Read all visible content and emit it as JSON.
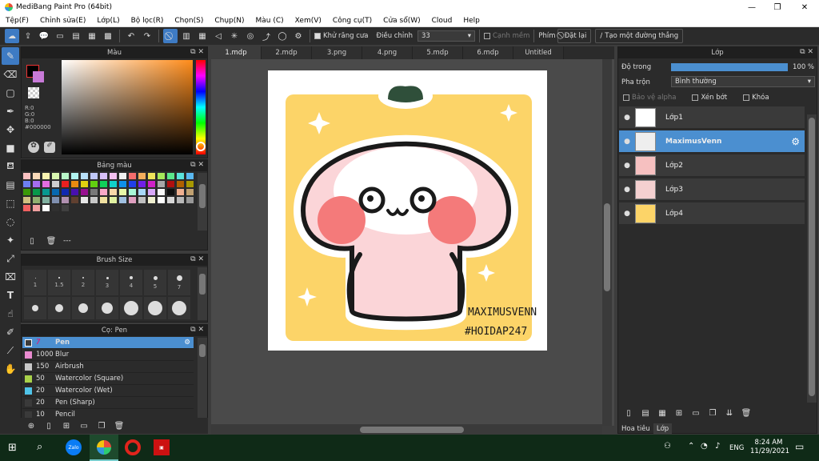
{
  "window": {
    "title": "MediBang Paint Pro (64bit)"
  },
  "menu": [
    "Tệp(F)",
    "Chỉnh sửa(E)",
    "Lớp(L)",
    "Bộ lọc(R)",
    "Chọn(S)",
    "Chụp(N)",
    "Màu (C)",
    "Xem(V)",
    "Công cụ(T)",
    "Cửa sổ(W)",
    "Cloud",
    "Help"
  ],
  "toolbar": {
    "antialias_label": "Khử răng cưa",
    "correction_label": "Điều chỉnh",
    "correction_value": "33",
    "soft_edge_label": "Cạnh mềm",
    "key_label": "Phím",
    "reset_label": "Đặt lại",
    "straight_line_label": "Tạo một đường thẳng"
  },
  "color_panel": {
    "title": "Màu",
    "r": "R:0",
    "g": "G:0",
    "b": "B:0",
    "hex": "#000000"
  },
  "palette_panel": {
    "title": "Bảng màu",
    "footer": "---"
  },
  "brush_size_panel": {
    "title": "Brush Size",
    "sizes_row1": [
      "1",
      "1.5",
      "2",
      "3",
      "4",
      "5",
      "7"
    ]
  },
  "brush_panel": {
    "title": "Cọ: Pen",
    "items": [
      {
        "size": "7",
        "name": "Pen",
        "color": "#3a3a3a",
        "selected": true
      },
      {
        "size": "1000",
        "name": "Blur",
        "color": "#e98bd0"
      },
      {
        "size": "150",
        "name": "Airbrush",
        "color": "#c8c8c8"
      },
      {
        "size": "50",
        "name": "Watercolor (Square)",
        "color": "#a8d14a"
      },
      {
        "size": "20",
        "name": "Watercolor (Wet)",
        "color": "#4fc3e8"
      },
      {
        "size": "20",
        "name": "Pen (Sharp)",
        "color": "#3a3a3a"
      },
      {
        "size": "10",
        "name": "Pencil",
        "color": "#3a3a3a"
      }
    ]
  },
  "tabs": [
    "1.mdp",
    "2.mdp",
    "3.png",
    "4.png",
    "5.mdp",
    "6.mdp",
    "Untitled"
  ],
  "canvas": {
    "signature_line1": "MAXIMUSVENN",
    "signature_line2": "#HOIDAP247"
  },
  "layer_panel": {
    "title": "Lớp",
    "opacity_label": "Độ trong",
    "opacity_value": "100 %",
    "opacity_fraction": 1.0,
    "blend_label": "Pha trộn",
    "blend_value": "Bình thường",
    "protect_alpha": "Bảo vệ alpha",
    "clipping": "Xén bớt",
    "lock": "Khóa",
    "layers": [
      {
        "name": "Lớp1",
        "selected": false
      },
      {
        "name": "MaximusVenn",
        "selected": true
      },
      {
        "name": "Lớp2",
        "selected": false
      },
      {
        "name": "Lớp3",
        "selected": false
      },
      {
        "name": "Lớp4",
        "selected": false
      }
    ],
    "bottom_tabs": [
      "Hoa tiêu",
      "Lớp"
    ]
  },
  "taskbar": {
    "lang": "ENG",
    "time": "8:24 AM",
    "date": "11/29/2021"
  },
  "colors": {
    "accent": "#4b8fd0",
    "canvas_bg": "#fcd468",
    "taskbar": "#0f2a17"
  }
}
